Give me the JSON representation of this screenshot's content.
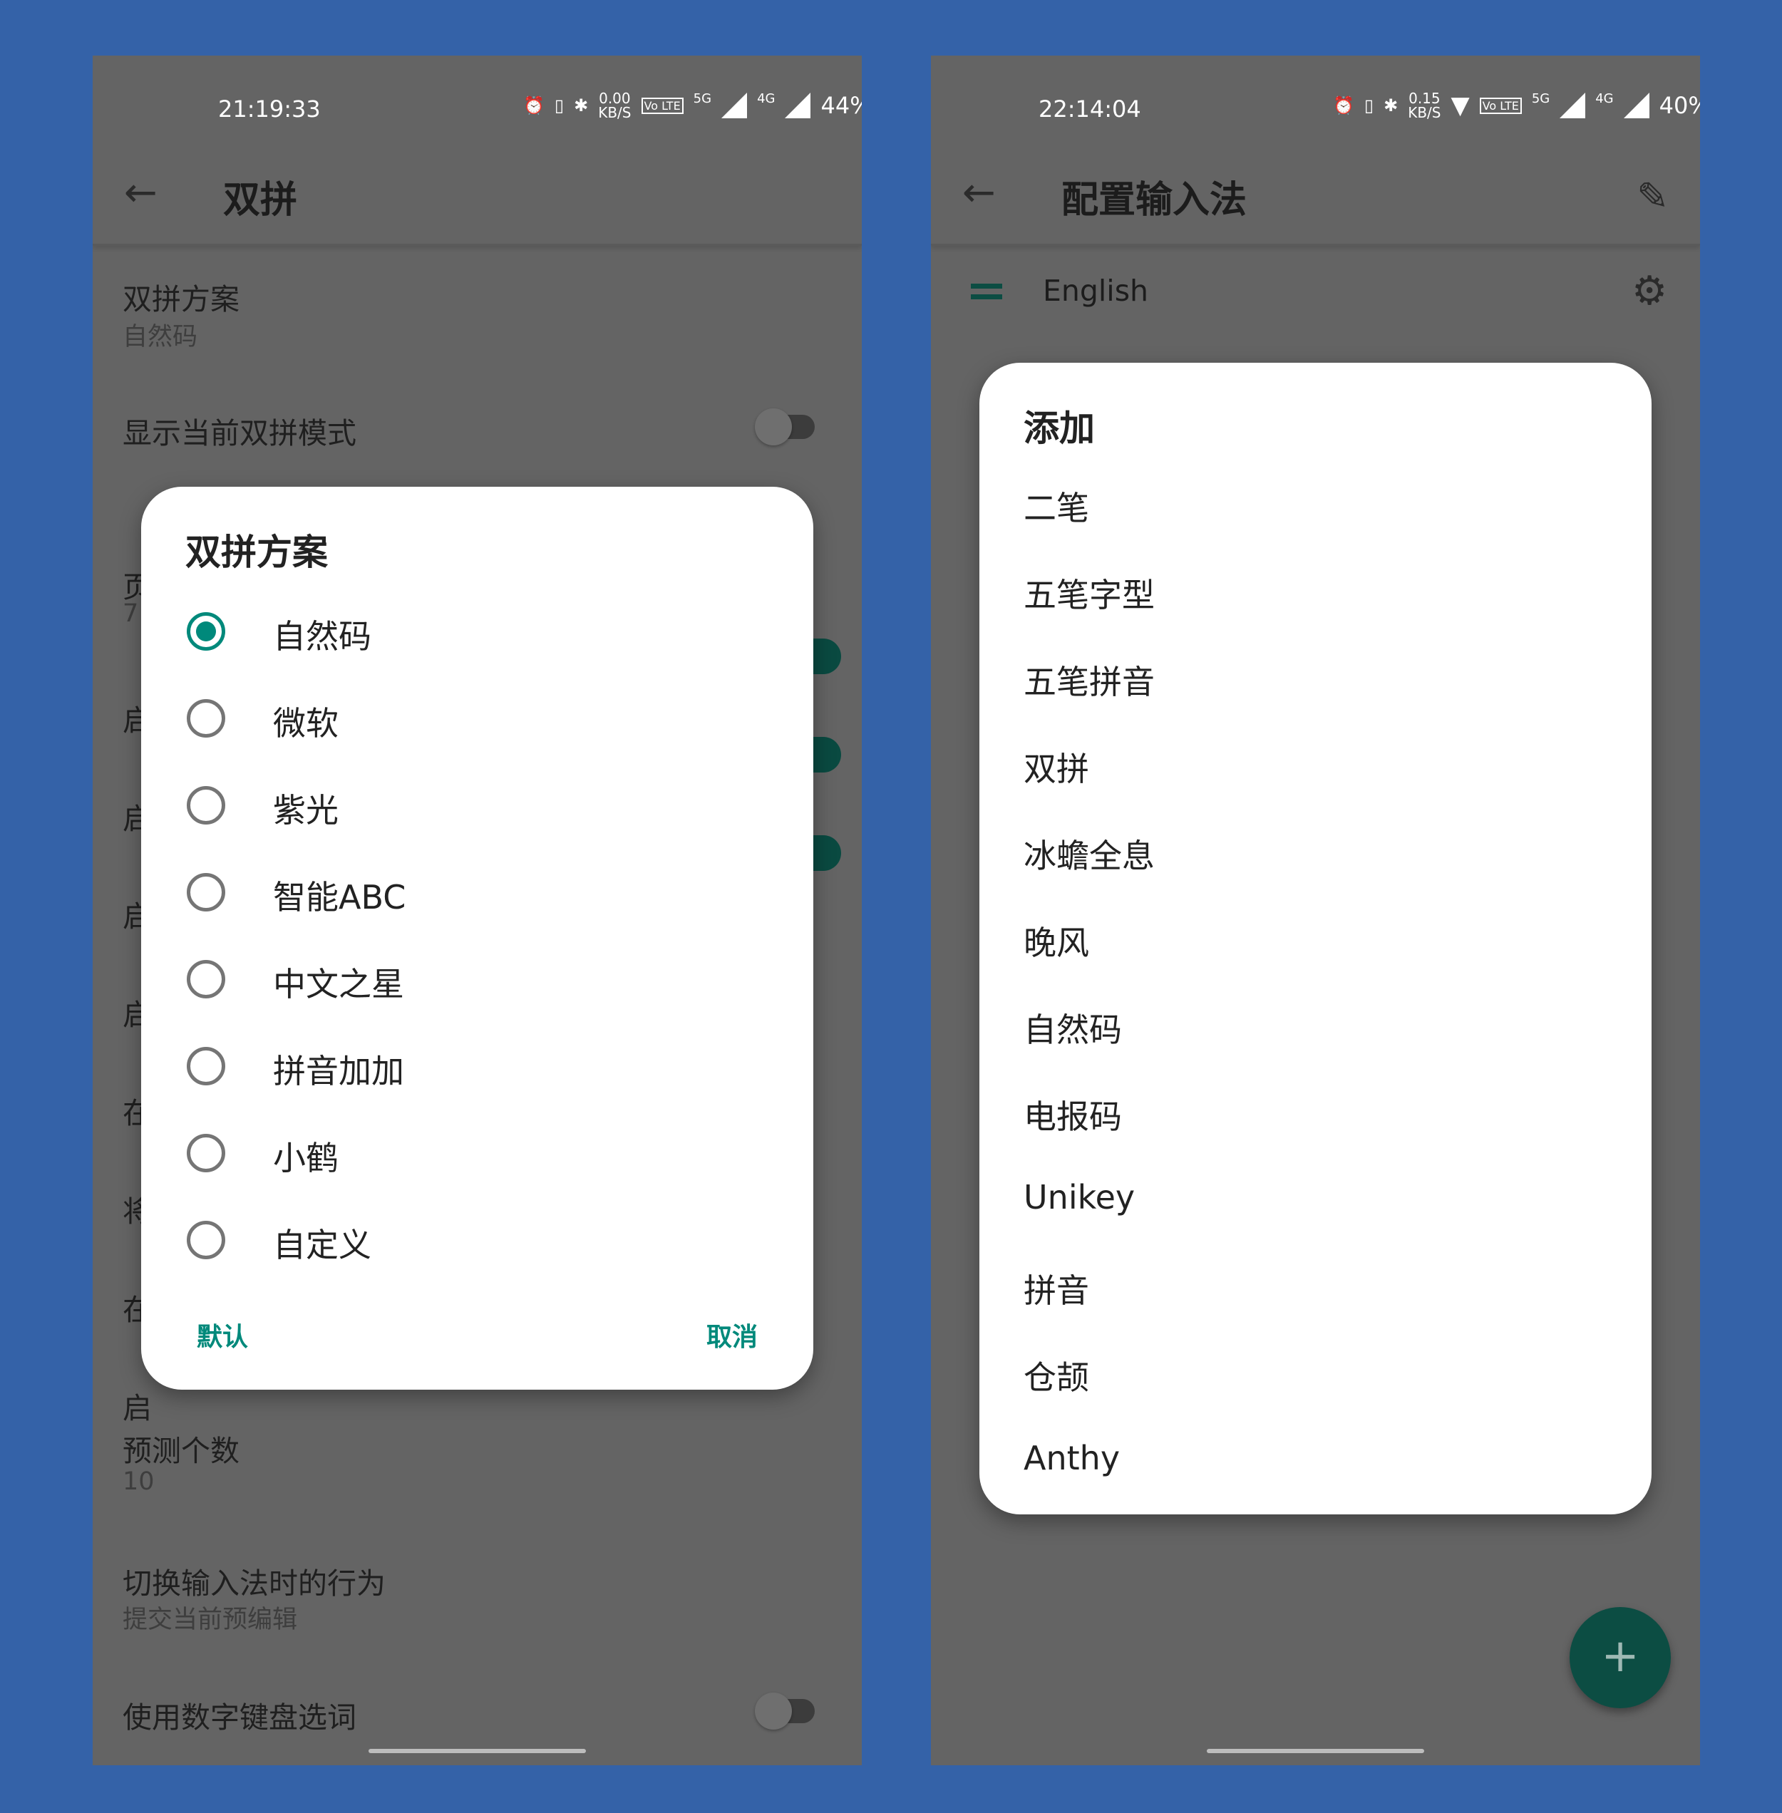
{
  "left": {
    "status": {
      "time": "21:19:33",
      "net_speed": "0.00",
      "net_unit": "KB/S",
      "volte": "Vo LTE",
      "sim1": "5G",
      "sim2": "4G",
      "battery": "44%"
    },
    "toolbar": {
      "back": "←",
      "title": "双拼"
    },
    "prefs": [
      {
        "title": "双拼方案",
        "summary": "自然码"
      },
      {
        "title": "显示当前双拼模式",
        "toggle": false
      }
    ],
    "hidden_prefs": [
      "页",
      "7",
      "启",
      "启",
      "启",
      "启",
      "在",
      "将",
      "在",
      "启"
    ],
    "lower_prefs": [
      {
        "title": "预测个数",
        "summary": "10"
      },
      {
        "title": "切换输入法时的行为",
        "summary": "提交当前预编辑"
      },
      {
        "title": "使用数字键盘选词",
        "toggle": false
      }
    ],
    "dialog": {
      "title": "双拼方案",
      "selected": 0,
      "options": [
        "自然码",
        "微软",
        "紫光",
        "智能ABC",
        "中文之星",
        "拼音加加",
        "小鹤",
        "自定义"
      ],
      "default_button": "默认",
      "cancel_button": "取消"
    }
  },
  "right": {
    "status": {
      "time": "22:14:04",
      "net_speed": "0.15",
      "net_unit": "KB/S",
      "volte": "Vo LTE",
      "sim1": "5G",
      "sim2": "4G",
      "battery": "40%"
    },
    "toolbar": {
      "back": "←",
      "title": "配置输入法",
      "edit_icon": "pencil-icon"
    },
    "enabled": [
      {
        "name": "English",
        "settings_icon": "gear-icon"
      }
    ],
    "dialog": {
      "title": "添加",
      "items": [
        "二笔",
        "五笔字型",
        "五笔拼音",
        "双拼",
        "冰蟾全息",
        "晚风",
        "自然码",
        "电报码",
        "Unikey",
        "拼音",
        "仓颉",
        "Anthy"
      ]
    },
    "fab": "+"
  },
  "colors": {
    "accent": "#00897b",
    "background": "#3462a8",
    "scrim_surface": "#646464",
    "fab": "#0c4d43"
  }
}
